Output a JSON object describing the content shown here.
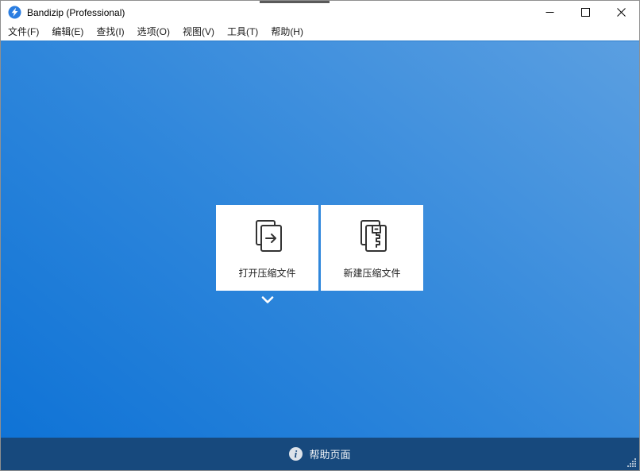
{
  "window": {
    "title": "Bandizip (Professional)",
    "app_icon": "bandizip-logo",
    "controls": [
      {
        "name": "minimize"
      },
      {
        "name": "maximize"
      },
      {
        "name": "close"
      }
    ]
  },
  "menubar": {
    "items": [
      {
        "label": "文件(F)"
      },
      {
        "label": "编辑(E)"
      },
      {
        "label": "查找(I)"
      },
      {
        "label": "选项(O)"
      },
      {
        "label": "视图(V)"
      },
      {
        "label": "工具(T)"
      },
      {
        "label": "帮助(H)"
      }
    ]
  },
  "main": {
    "cards": [
      {
        "label": "打开压缩文件",
        "icon": "open-archive-icon"
      },
      {
        "label": "新建压缩文件",
        "icon": "new-archive-icon"
      }
    ],
    "more_icon": "chevron-down-icon"
  },
  "statusbar": {
    "help_label": "帮助页面",
    "icon": "info-icon"
  },
  "colors": {
    "gradient_light": "#5b9fe1",
    "gradient_deep": "#0f73d6",
    "statusbar_bg": "#17497d",
    "titlebar_bg": "#ffffff",
    "card_bg": "#ffffff",
    "card_text": "#222222",
    "logo_blue": "#2a7de1"
  }
}
